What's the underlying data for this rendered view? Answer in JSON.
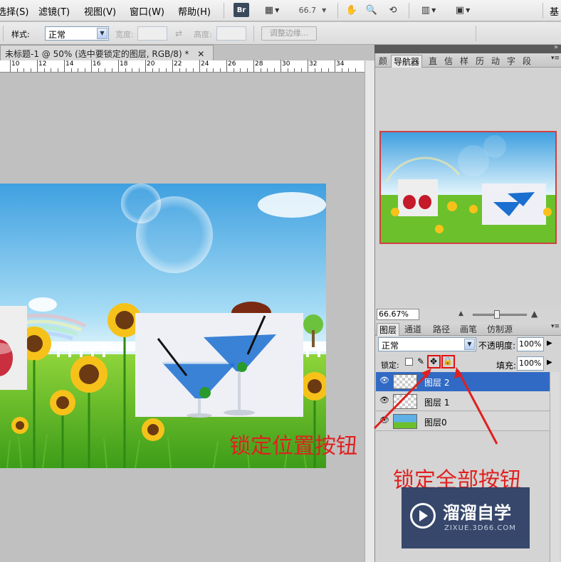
{
  "menu": {
    "items": [
      "选择(S)",
      "滤镜(T)",
      "视图(V)",
      "窗口(W)",
      "帮助(H)"
    ],
    "zoom": "66.7",
    "br_label": "Br",
    "right_label": "基"
  },
  "options": {
    "style_label": "样式:",
    "style_value": "正常",
    "width_label": "宽度:",
    "height_label": "高度:",
    "refine_label": "调整边缘..."
  },
  "document": {
    "tab_title": "未标题-1 @ 50% (选中要锁定的图层, RGB/8) *",
    "ruler_labels": [
      "10",
      "12",
      "14",
      "16",
      "18",
      "20",
      "22",
      "24",
      "26",
      "28",
      "30",
      "32",
      "34"
    ]
  },
  "navigator": {
    "tabs": [
      "颜",
      "导航器",
      "直",
      "信",
      "样",
      "历",
      "动",
      "字",
      "段"
    ],
    "zoom_value": "66.67%"
  },
  "layers": {
    "tabs": [
      "图层",
      "通道",
      "路径",
      "画笔",
      "仿制源"
    ],
    "blend_mode": "正常",
    "opacity_label": "不透明度:",
    "opacity_value": "100%",
    "lock_label": "锁定:",
    "fill_label": "填充:",
    "fill_value": "100%",
    "rows": [
      {
        "name": "图层 2",
        "selected": true
      },
      {
        "name": "图层 1",
        "selected": false
      },
      {
        "name": "图层0",
        "selected": false
      }
    ]
  },
  "annotations": {
    "lock_position": "锁定位置按钮",
    "lock_all": "锁定全部按钮"
  },
  "watermark": {
    "title": "溜溜自学",
    "url": "ZIXUE.3D66.COM"
  },
  "colors": {
    "accent_red": "#e02020",
    "selection_blue": "#316ac5"
  }
}
